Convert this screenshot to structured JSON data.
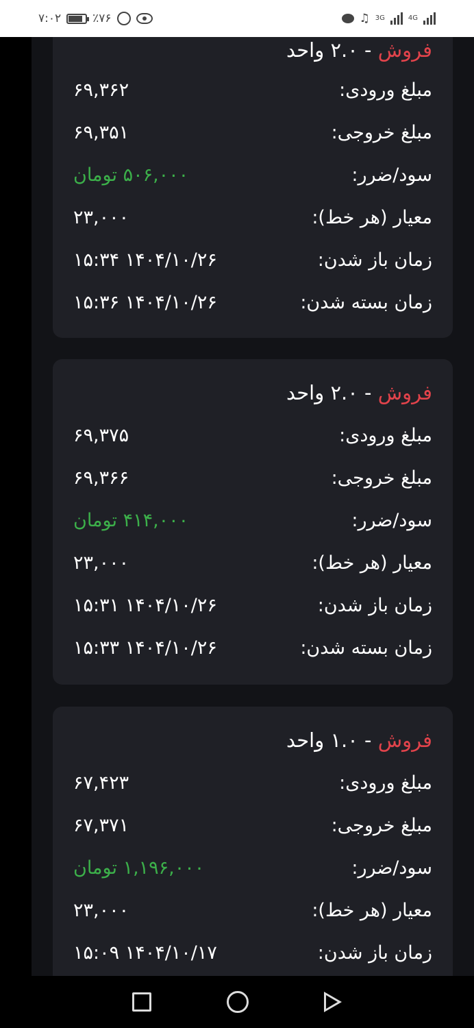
{
  "status_bar": {
    "time": "۷:۰۲",
    "battery_percent": "٪۷۶",
    "battery_level": 0.76,
    "net_3g": "3G",
    "net_4g": "4G",
    "icons": [
      "battery-icon",
      "alarm-icon",
      "eye-icon",
      "chat-bubble-icon",
      "music-note-icon",
      "signal-icon"
    ]
  },
  "colors": {
    "background": "#121317",
    "card": "#1f2026",
    "sell": "#e2434b",
    "profit": "#3cb04a",
    "text": "#ffffff"
  },
  "labels": {
    "entry": "مبلغ ورودی:",
    "exit": "مبلغ خروجی:",
    "pnl": "سود/ضرر:",
    "pip": "معیار (هر خط):",
    "open": "زمان باز شدن:",
    "close": "زمان بسته شدن:"
  },
  "trades": [
    {
      "side": "فروش",
      "qty": " - ۲.۰ واحد",
      "entry": "۶۹,۳۶۲",
      "exit": "۶۹,۳۵۱",
      "pnl": "۵۰۶,۰۰۰ تومان",
      "pip": "۲۳,۰۰۰",
      "open": "۱۴۰۴/۱۰/۲۶ ۱۵:۳۴",
      "close": "۱۴۰۴/۱۰/۲۶ ۱۵:۳۶"
    },
    {
      "side": "فروش",
      "qty": " - ۲.۰ واحد",
      "entry": "۶۹,۳۷۵",
      "exit": "۶۹,۳۶۶",
      "pnl": "۴۱۴,۰۰۰ تومان",
      "pip": "۲۳,۰۰۰",
      "open": "۱۴۰۴/۱۰/۲۶ ۱۵:۳۱",
      "close": "۱۴۰۴/۱۰/۲۶ ۱۵:۳۳"
    },
    {
      "side": "فروش",
      "qty": " - ۱.۰ واحد",
      "entry": "۶۷,۴۲۳",
      "exit": "۶۷,۳۷۱",
      "pnl": "۱,۱۹۶,۰۰۰ تومان",
      "pip": "۲۳,۰۰۰",
      "open": "۱۴۰۴/۱۰/۱۷ ۱۵:۰۹"
    }
  ],
  "nav": {
    "icons": [
      "recents-square-icon",
      "home-circle-icon",
      "back-triangle-icon"
    ]
  }
}
